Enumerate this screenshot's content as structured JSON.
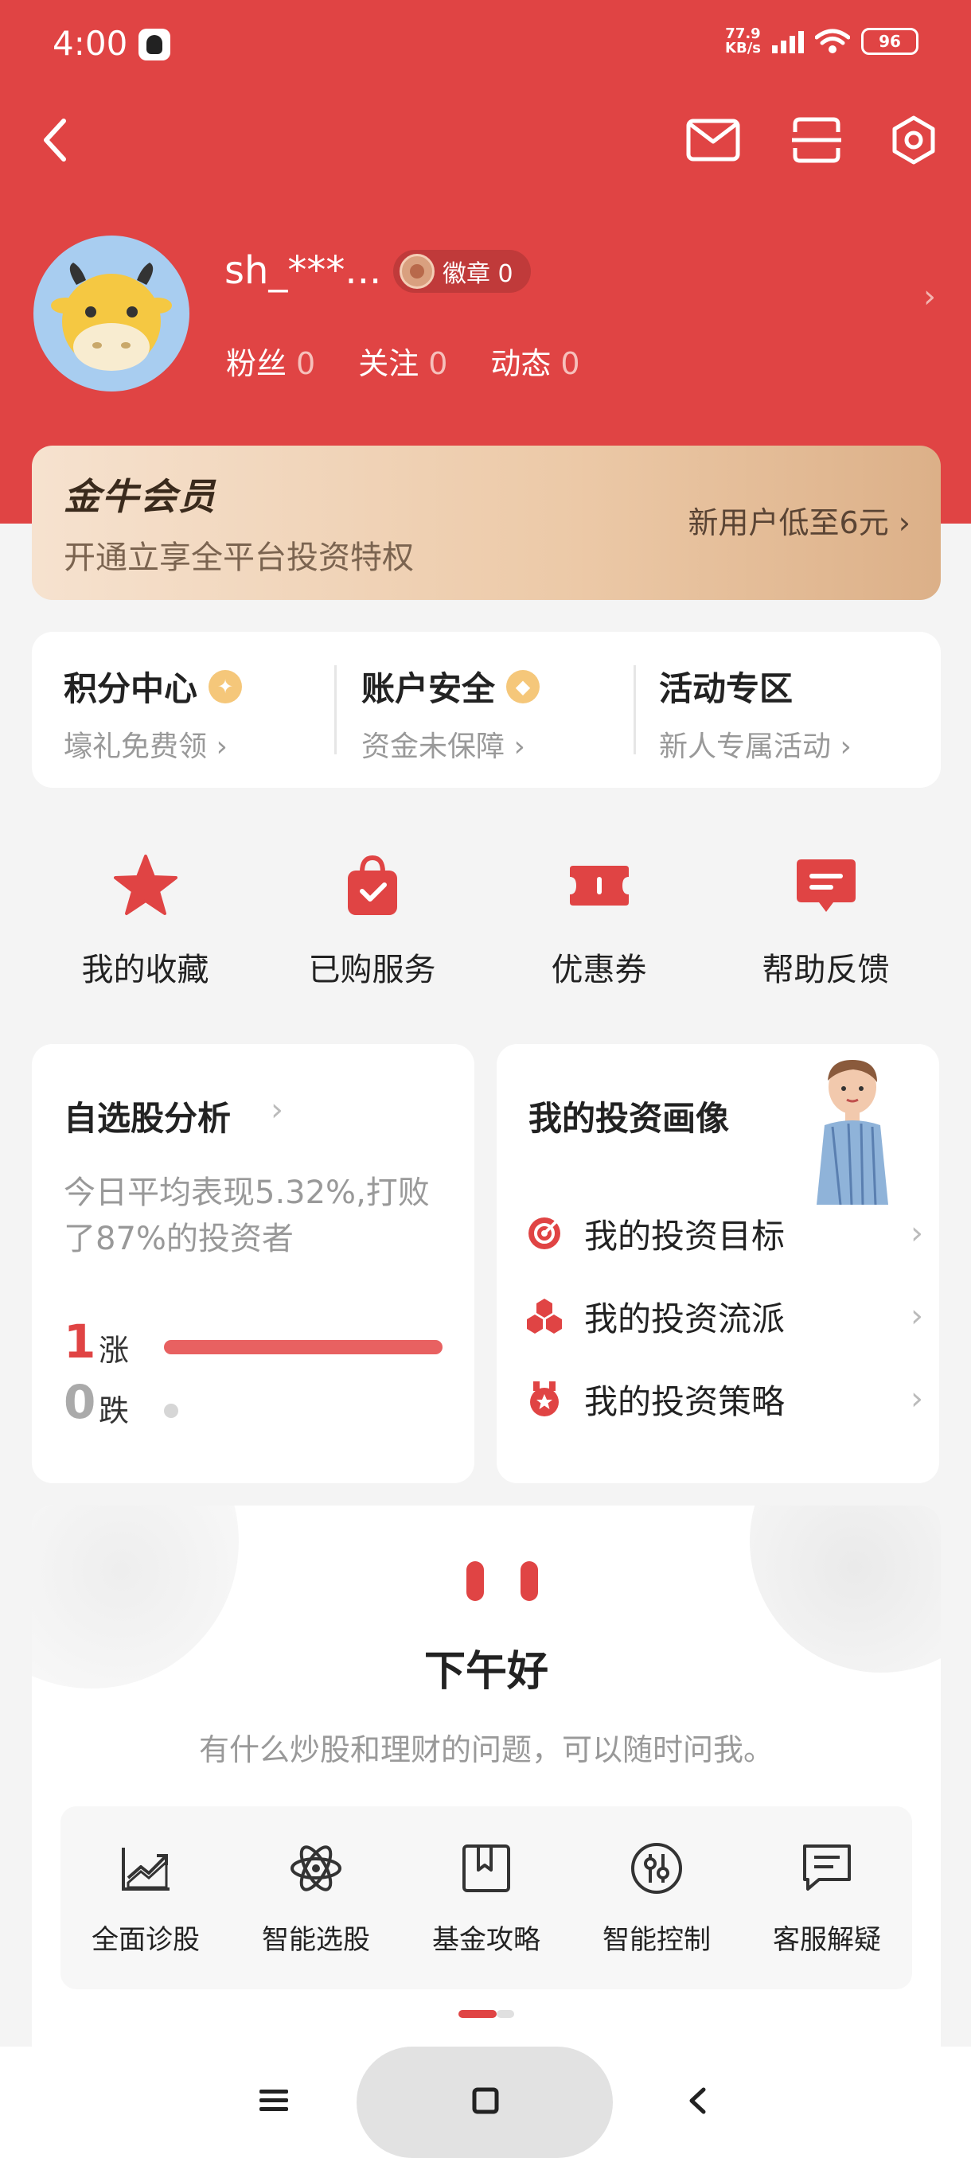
{
  "status_bar": {
    "time": "4:00",
    "net_speed_top": "77.9",
    "net_speed_unit": "KB/s",
    "battery": "96"
  },
  "profile": {
    "username": "sh_***...",
    "badge_label": "徽章 0",
    "stats": [
      {
        "label": "粉丝",
        "value": "0"
      },
      {
        "label": "关注",
        "value": "0"
      },
      {
        "label": "动态",
        "value": "0"
      }
    ]
  },
  "vip": {
    "title": "金牛会员",
    "description": "开通立享全平台投资特权",
    "offer": "新用户低至6元"
  },
  "features": [
    {
      "title": "积分中心",
      "subtitle": "壕礼免费领"
    },
    {
      "title": "账户安全",
      "subtitle": "资金未保障"
    },
    {
      "title": "活动专区",
      "subtitle": "新人专属活动"
    }
  ],
  "quick_actions": [
    {
      "label": "我的收藏",
      "icon": "star-icon"
    },
    {
      "label": "已购服务",
      "icon": "shopping-bag-icon"
    },
    {
      "label": "优惠券",
      "icon": "coupon-icon"
    },
    {
      "label": "帮助反馈",
      "icon": "feedback-icon"
    }
  ],
  "stock_analysis": {
    "title": "自选股分析",
    "summary": "今日平均表现5.32%,打败了87%的投资者",
    "rise_count": "1",
    "rise_label": "涨",
    "fall_count": "0",
    "fall_label": "跌",
    "rise_fraction": 1.0
  },
  "investment_profile": {
    "title": "我的投资画像",
    "items": [
      {
        "label": "我的投资目标",
        "icon": "target-icon"
      },
      {
        "label": "我的投资流派",
        "icon": "hexagons-icon"
      },
      {
        "label": "我的投资策略",
        "icon": "medal-icon"
      }
    ]
  },
  "assistant": {
    "greeting": "下午好",
    "subtitle": "有什么炒股和理财的问题，可以随时问我。",
    "tools": [
      {
        "label": "全面诊股",
        "icon": "chart-trend-icon"
      },
      {
        "label": "智能选股",
        "icon": "atom-icon"
      },
      {
        "label": "基金攻略",
        "icon": "bookmark-box-icon"
      },
      {
        "label": "智能控制",
        "icon": "sliders-icon"
      },
      {
        "label": "客服解疑",
        "icon": "chat-icon"
      }
    ]
  },
  "colors": {
    "brand_red": "#e04444",
    "vip_gold": "#ecc9a7"
  }
}
